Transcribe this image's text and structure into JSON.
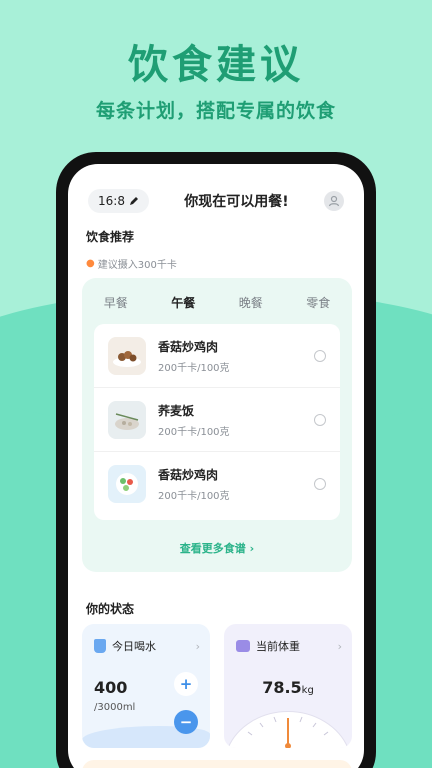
{
  "hero": {
    "title": "饮食建议",
    "subtitle": "每条计划，搭配专属的饮食"
  },
  "status_bar": {
    "time": "16:8",
    "title": "你现在可以用餐!"
  },
  "diet": {
    "section_title": "饮食推荐",
    "hint": "建议摄入300千卡",
    "tabs": [
      {
        "label": "早餐",
        "active": false
      },
      {
        "label": "午餐",
        "active": true
      },
      {
        "label": "晚餐",
        "active": false
      },
      {
        "label": "零食",
        "active": false
      }
    ],
    "foods": [
      {
        "name": "香菇炒鸡肉",
        "calories": "200千卡/100克"
      },
      {
        "name": "荞麦饭",
        "calories": "200千卡/100克"
      },
      {
        "name": "香菇炒鸡肉",
        "calories": "200千卡/100克"
      }
    ],
    "more_link": "查看更多食谱"
  },
  "status": {
    "section_title": "你的状态",
    "water": {
      "label": "今日喝水",
      "value": "400",
      "goal": "/3000ml",
      "plus": "+",
      "minus": "−"
    },
    "weight": {
      "label": "当前体重",
      "value": "78.5",
      "unit": "kg"
    }
  },
  "colors": {
    "accent": "#1f9e74",
    "link": "#2bb38a",
    "water_blue": "#4a96ec"
  },
  "icons": {
    "pen": "pen-icon",
    "avatar": "user-icon",
    "fire": "fire-icon",
    "cup": "cup-icon",
    "scale": "scale-icon",
    "chevron": "chevron-right-icon"
  }
}
